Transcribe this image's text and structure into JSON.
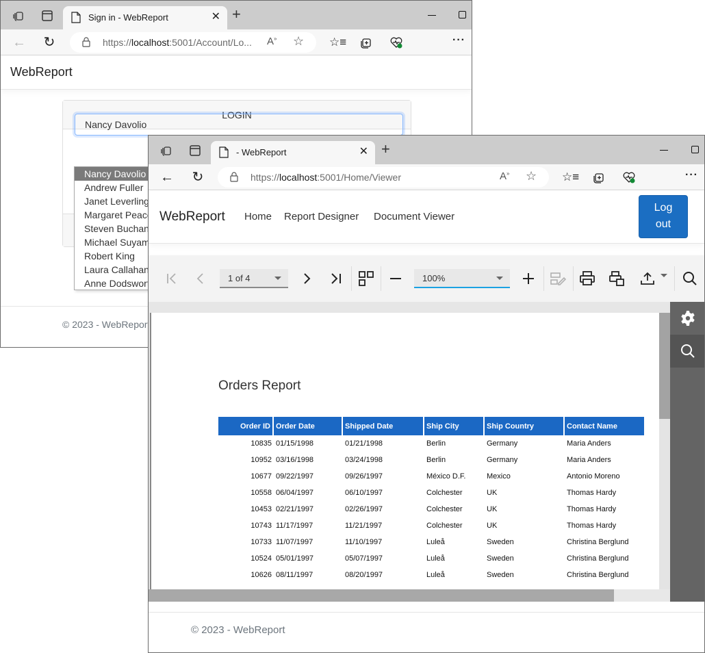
{
  "back_window": {
    "tab_title": "Sign in - WebReport",
    "url_prefix": "https://",
    "url_host": "localhost",
    "url_rest": ":5001/Account/Lo...",
    "brand": "WebReport",
    "login": {
      "heading": "LOGIN",
      "selected_user": "Nancy Davolio",
      "options": [
        "Nancy Davolio",
        "Andrew Fuller",
        "Janet Leverling",
        "Margaret Peacock",
        "Steven Buchanan",
        "Michael Suyama",
        "Robert King",
        "Laura Callahan",
        "Anne Dodsworth"
      ]
    },
    "footer": "© 2023 - WebReport"
  },
  "front_window": {
    "tab_title": "- WebReport",
    "url_prefix": "https://",
    "url_host": "localhost",
    "url_rest": ":5001/Home/Viewer",
    "brand": "WebReport",
    "nav": [
      "Home",
      "Report Designer",
      "Document Viewer"
    ],
    "logout_line1": "Log",
    "logout_line2": "out",
    "toolbar": {
      "page_selector": "1 of 4",
      "zoom": "100%"
    },
    "report": {
      "title": "Orders Report",
      "columns": [
        "Order ID",
        "Order Date",
        "Shipped Date",
        "Ship City",
        "Ship Country",
        "Contact Name"
      ],
      "rows": [
        [
          "10835",
          "01/15/1998",
          "01/21/1998",
          "Berlin",
          "Germany",
          "Maria Anders"
        ],
        [
          "10952",
          "03/16/1998",
          "03/24/1998",
          "Berlin",
          "Germany",
          "Maria Anders"
        ],
        [
          "10677",
          "09/22/1997",
          "09/26/1997",
          "México D.F.",
          "Mexico",
          "Antonio Moreno"
        ],
        [
          "10558",
          "06/04/1997",
          "06/10/1997",
          "Colchester",
          "UK",
          "Thomas Hardy"
        ],
        [
          "10453",
          "02/21/1997",
          "02/26/1997",
          "Colchester",
          "UK",
          "Thomas Hardy"
        ],
        [
          "10743",
          "11/17/1997",
          "11/21/1997",
          "Colchester",
          "UK",
          "Thomas Hardy"
        ],
        [
          "10733",
          "11/07/1997",
          "11/10/1997",
          "Luleå",
          "Sweden",
          "Christina Berglund"
        ],
        [
          "10524",
          "05/01/1997",
          "05/07/1997",
          "Luleå",
          "Sweden",
          "Christina Berglund"
        ],
        [
          "10626",
          "08/11/1997",
          "08/20/1997",
          "Luleå",
          "Sweden",
          "Christina Berglund"
        ]
      ]
    },
    "footer": "© 2023 - WebReport"
  },
  "colors": {
    "accent": "#1b6ec2",
    "table_header": "#1b68c4",
    "side_panel": "#646464"
  }
}
